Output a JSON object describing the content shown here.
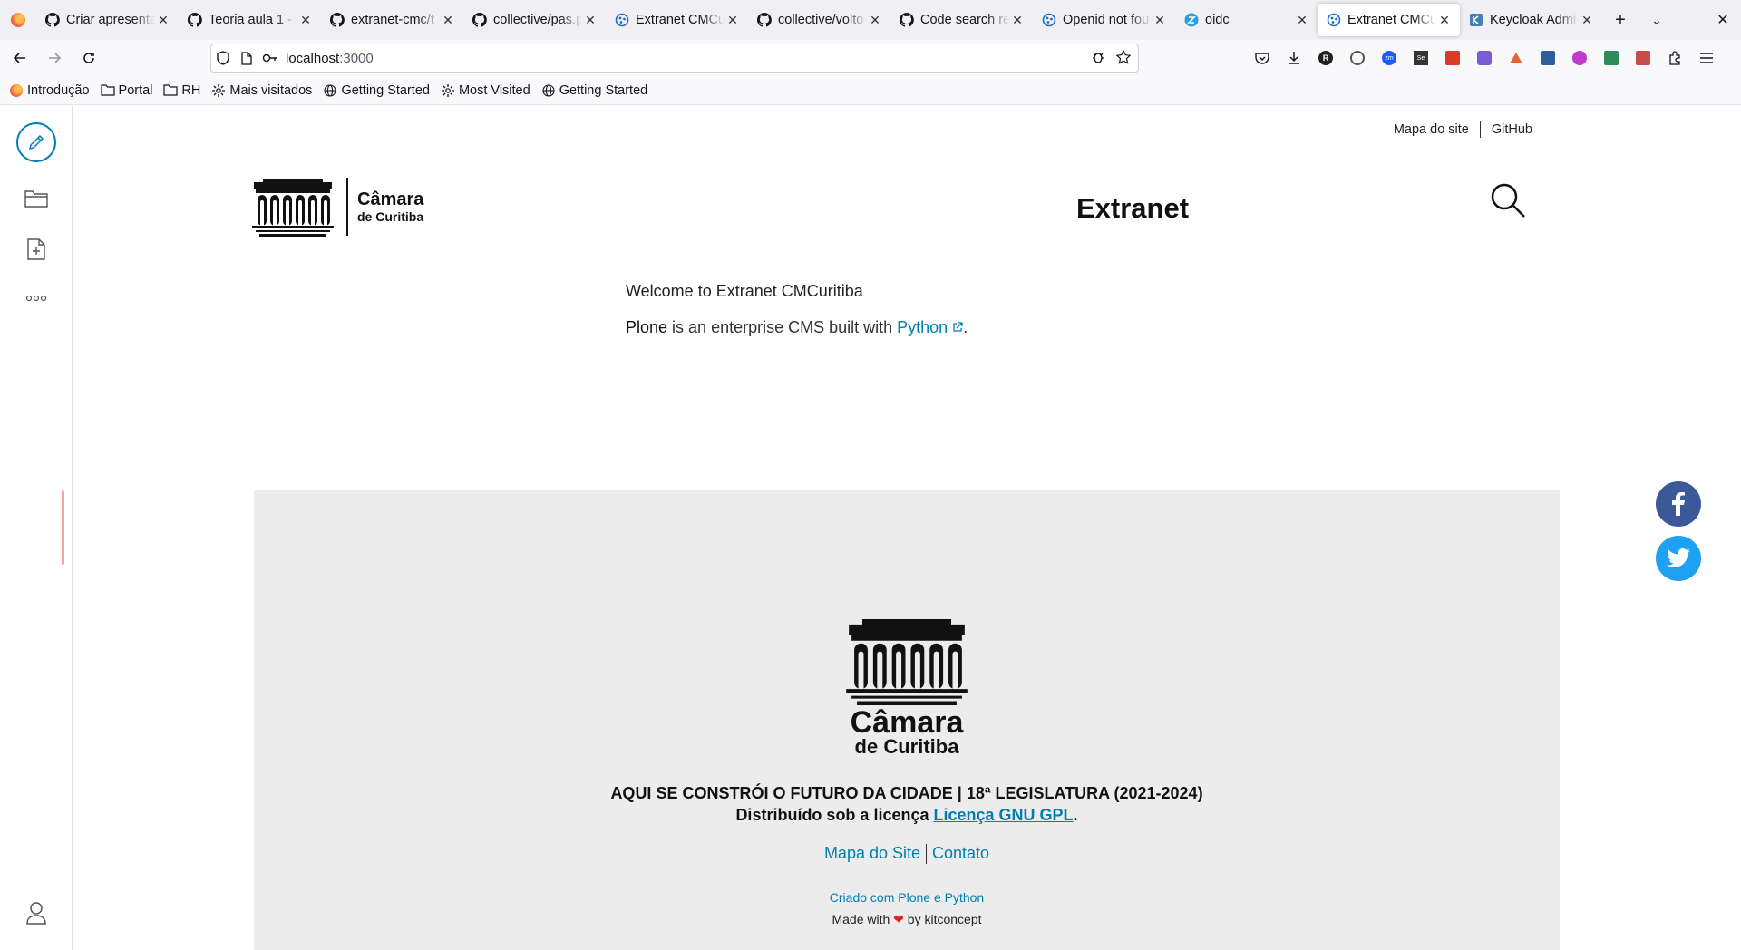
{
  "browser": {
    "tabs": [
      {
        "title": "Criar apresenta",
        "icon": "github-icon"
      },
      {
        "title": "Teoria aula 1 - I",
        "icon": "github-icon"
      },
      {
        "title": "extranet-cmc/t",
        "icon": "github-icon"
      },
      {
        "title": "collective/pas.p",
        "icon": "github-icon"
      },
      {
        "title": "Extranet CMCu",
        "icon": "plone-icon"
      },
      {
        "title": "collective/volto",
        "icon": "github-icon"
      },
      {
        "title": "Code search re",
        "icon": "github-icon"
      },
      {
        "title": "Openid not fou",
        "icon": "plone-icon"
      },
      {
        "title": "oidc",
        "icon": "zotero-icon"
      },
      {
        "title": "Extranet CMCu",
        "icon": "plone-icon",
        "active": true
      },
      {
        "title": "Keycloak Admi",
        "icon": "keycloak-icon"
      }
    ],
    "url": {
      "host": "localhost",
      "port": ":3000"
    },
    "bookmarks": [
      {
        "label": "Introdução",
        "icon": "firefox-icon"
      },
      {
        "label": "Portal",
        "icon": "folder-icon"
      },
      {
        "label": "RH",
        "icon": "folder-icon"
      },
      {
        "label": "Mais visitados",
        "icon": "gear-icon"
      },
      {
        "label": "Getting Started",
        "icon": "globe-icon"
      },
      {
        "label": "Most Visited",
        "icon": "gear-icon"
      },
      {
        "label": "Getting Started",
        "icon": "globe-icon"
      }
    ]
  },
  "header": {
    "top_links": [
      "Mapa do site",
      "GitHub"
    ],
    "logo_line1": "Câmara",
    "logo_line2": "de Curitiba",
    "site_title": "Extranet"
  },
  "document": {
    "welcome": "Welcome to Extranet CMCuritiba",
    "plone_word": "Plone",
    "body_text": " is an enterprise CMS built with ",
    "python_link": "Python",
    "end_punct": "."
  },
  "footer": {
    "logo_line1": "Câmara",
    "logo_line2": "de Curitiba",
    "tagline": "AQUI SE CONSTRÓI O FUTURO DA CIDADE | 18ª LEGISLATURA (2021-2024)",
    "license_prefix": "Distribuído sob a licença ",
    "license_link": "Licença GNU GPL",
    "license_suffix": ".",
    "links": [
      "Mapa do Site",
      "Contato"
    ],
    "created_with": "Criado com Plone e Python",
    "made_with_prefix": "Made with ",
    "made_with_suffix": " by kitconcept"
  },
  "colors": {
    "link": "#007eb1",
    "facebook": "#3b5998",
    "twitter": "#1da1f2",
    "footer_bg": "#ececec"
  }
}
